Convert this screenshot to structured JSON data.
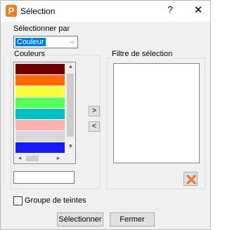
{
  "window": {
    "title": "Sélection",
    "help": "?",
    "close": "✕",
    "app_icon_letter": "P"
  },
  "select_by": {
    "label": "Sélectionner par",
    "value": "Couleur"
  },
  "colors_group": {
    "title": "Couleurs",
    "swatches": [
      "#6e0000",
      "#ff6a00",
      "#ffff3c",
      "#57ff57",
      "#00c0c0",
      "#ffb0b0",
      "#d8d8d8",
      "#1a1aff"
    ],
    "input_value": ""
  },
  "transfer": {
    "add_label": ">",
    "remove_label": "<"
  },
  "filter_group": {
    "title": "Filtre de sélection",
    "items": []
  },
  "tint_group": {
    "label": "Groupe de teintes",
    "checked": false
  },
  "buttons": {
    "select_label": "Sélectionner",
    "close_label": "Fermer"
  }
}
